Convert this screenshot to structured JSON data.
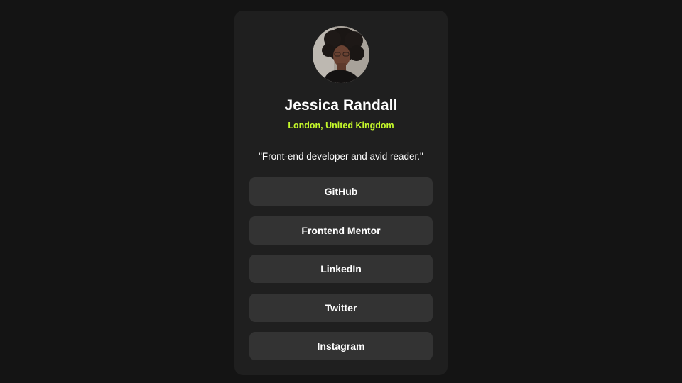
{
  "profile": {
    "avatar_icon": "profile-photo",
    "name": "Jessica Randall",
    "location": "London, United Kingdom",
    "bio": "\"Front-end developer and avid reader.\""
  },
  "links": [
    {
      "label": "GitHub"
    },
    {
      "label": "Frontend Mentor"
    },
    {
      "label": "LinkedIn"
    },
    {
      "label": "Twitter"
    },
    {
      "label": "Instagram"
    }
  ],
  "colors": {
    "page_background": "#141414",
    "card_background": "#1f1f1f",
    "button_background": "#333333",
    "accent_location": "#c4f82a",
    "text": "#ffffff"
  }
}
